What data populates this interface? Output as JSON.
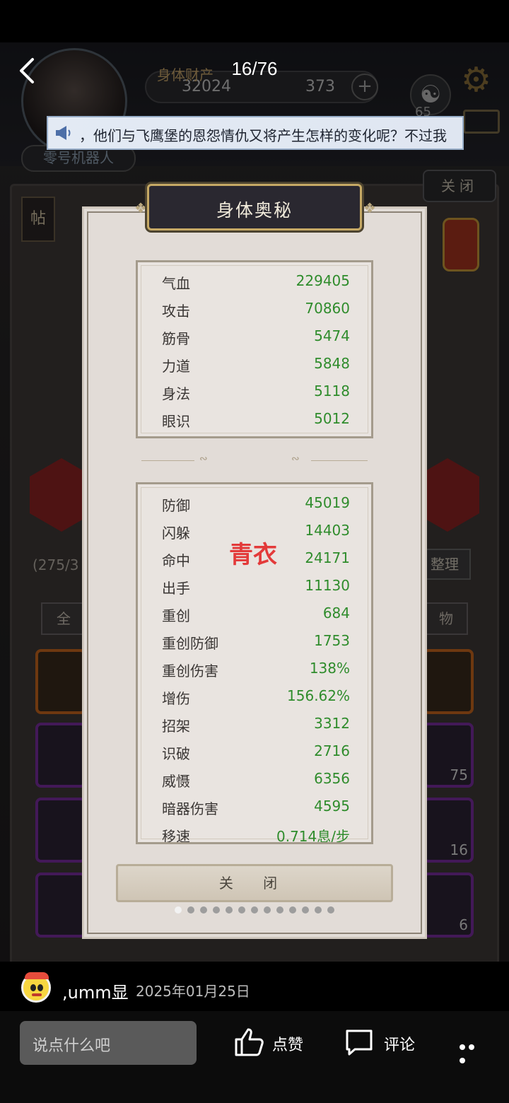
{
  "viewer": {
    "page_counter": "16/76"
  },
  "background": {
    "title_faded": "身体财产",
    "currency_1": "32024",
    "currency_2": "373",
    "plus": "+",
    "yin_yang_count": "65",
    "robot_tag": "零号机器人",
    "notice_text": "，他们与飞鹰堡的恩怨情仇又将产生怎样的变化呢？不过我",
    "close_top": "关闭",
    "post_tag": "帖",
    "inventory_count": "(275/3",
    "tidy_button": "整理",
    "tab_all": "全",
    "tab_items": "物",
    "slot_counts": [
      "75",
      "16",
      "6"
    ]
  },
  "modal": {
    "title": "身体奥秘",
    "primary_stats": [
      {
        "label": "气血",
        "value": "229405"
      },
      {
        "label": "攻击",
        "value": "70860"
      },
      {
        "label": "筋骨",
        "value": "5474"
      },
      {
        "label": "力道",
        "value": "5848"
      },
      {
        "label": "身法",
        "value": "5118"
      },
      {
        "label": "眼识",
        "value": "5012"
      }
    ],
    "secondary_stats": [
      {
        "label": "防御",
        "value": "45019"
      },
      {
        "label": "闪躲",
        "value": "14403"
      },
      {
        "label": "命中",
        "value": "24171"
      },
      {
        "label": "出手",
        "value": "11130"
      },
      {
        "label": "重创",
        "value": "684"
      },
      {
        "label": "重创防御",
        "value": "1753"
      },
      {
        "label": "重创伤害",
        "value": "138%"
      },
      {
        "label": "增伤",
        "value": "156.62%"
      },
      {
        "label": "招架",
        "value": "3312"
      },
      {
        "label": "识破",
        "value": "2716"
      },
      {
        "label": "威慑",
        "value": "6356"
      },
      {
        "label": "暗器伤害",
        "value": "4595"
      },
      {
        "label": "移速",
        "value": "0.714息/步"
      }
    ],
    "watermark": "青衣",
    "close_label": "关 闭"
  },
  "post": {
    "username": ",umm显",
    "date": "2025年01月25日"
  },
  "footer": {
    "input_placeholder": "说点什么吧",
    "like_label": "点赞",
    "comment_label": "评论"
  },
  "colors": {
    "stat_value": "#2f8c2c",
    "watermark": "#e33a3a"
  }
}
